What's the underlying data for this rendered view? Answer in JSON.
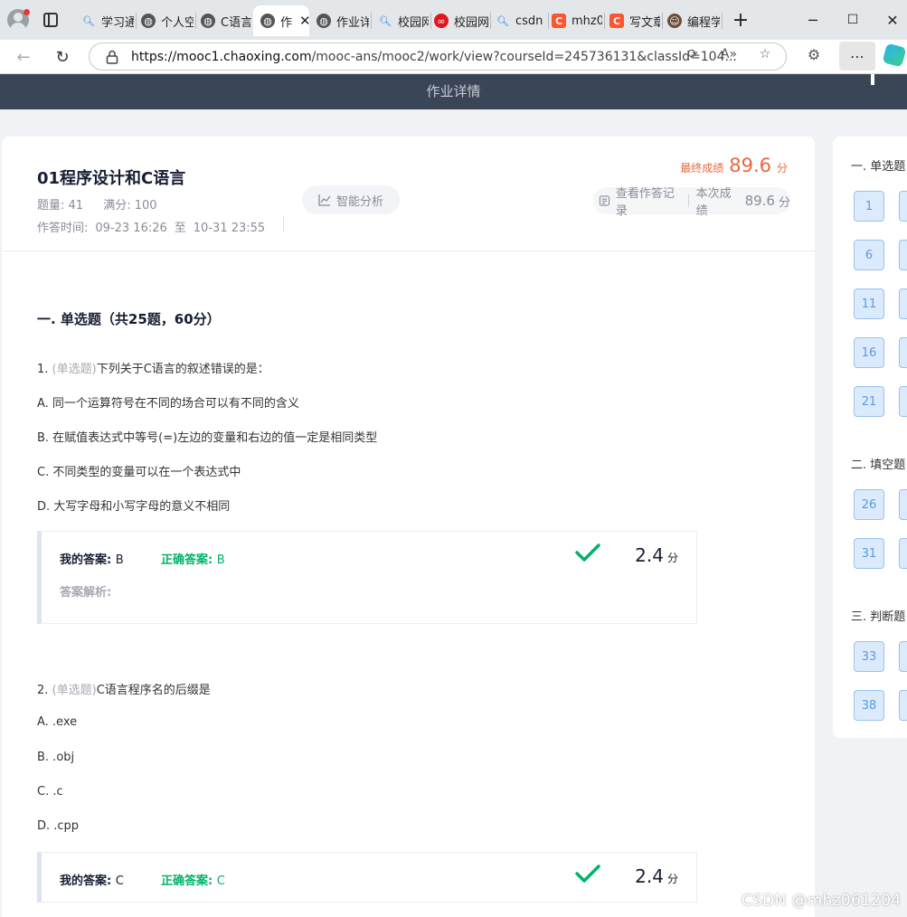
{
  "browser": {
    "tabs": [
      {
        "label": "学习通",
        "icon": "search-icon"
      },
      {
        "label": "个人空",
        "icon": "globe-icon"
      },
      {
        "label": "C语言",
        "icon": "globe-icon"
      },
      {
        "label": "作",
        "icon": "globe-icon",
        "active": true
      },
      {
        "label": "作业详",
        "icon": "globe-icon"
      },
      {
        "label": "校园网",
        "icon": "search-icon"
      },
      {
        "label": "校园网",
        "icon": "weibo-icon"
      },
      {
        "label": "csdn",
        "icon": "search-icon"
      },
      {
        "label": "mhz0",
        "icon": "csdn-icon"
      },
      {
        "label": "写文章",
        "icon": "csdn-icon"
      },
      {
        "label": "编程学",
        "icon": "avatar-icon"
      }
    ],
    "url_host": "https://mooc1.chaoxing.com",
    "url_path": "/mooc-ans/mooc2/work/view?courseId=245736131&classId=104..."
  },
  "header": {
    "title": "作业详情"
  },
  "work": {
    "title": "01程序设计和C语言",
    "question_count_label": "题量: 41",
    "full_score_label": "满分: 100",
    "time_label": "作答时间:",
    "time_start": "09-23 16:26",
    "time_to": "至",
    "time_end": "10-31 23:55",
    "analysis_button": "智能分析",
    "final_score_label": "最终成绩",
    "final_score": "89.6",
    "score_unit": "分",
    "record_label": "查看作答记录",
    "this_score_label": "本次成绩",
    "this_score": "89.6"
  },
  "section": {
    "title": "一. 单选题（共25题，60分）"
  },
  "questions": [
    {
      "num": "1.",
      "type": "(单选题)",
      "text": "下列关于C语言的叙述错误的是：",
      "options": [
        "A. 同一个运算符号在不同的场合可以有不同的含义",
        "B. 在赋值表达式中等号(=)左边的变量和右边的值一定是相同类型",
        "C. 不同类型的变量可以在一个表达式中",
        "D. 大写字母和小写字母的意义不相同"
      ],
      "my_answer_label": "我的答案:",
      "my_answer": "B",
      "correct_label": "正确答案:",
      "correct": "B",
      "score": "2.4",
      "unit": "分",
      "analysis_label": "答案解析:"
    },
    {
      "num": "2.",
      "type": "(单选题)",
      "text": "C语言程序名的后缀是",
      "options": [
        "A. .exe",
        "B. .obj",
        "C. .c",
        "D. .cpp"
      ],
      "my_answer_label": "我的答案:",
      "my_answer": "C",
      "correct_label": "正确答案:",
      "correct": "C",
      "score": "2.4",
      "unit": "分"
    }
  ],
  "nav": {
    "sections": [
      "一. 单选题",
      "二. 填空题",
      "三. 判断题"
    ],
    "numbers": [
      "1",
      "6",
      "11",
      "16",
      "21",
      "26",
      "31",
      "33",
      "38"
    ]
  },
  "watermark": "CSDN @mhz061204",
  "colors": {
    "header": "#3a4556",
    "accent": "#e8683e",
    "correct": "#00b368",
    "nav_box": "#dbeafc"
  }
}
